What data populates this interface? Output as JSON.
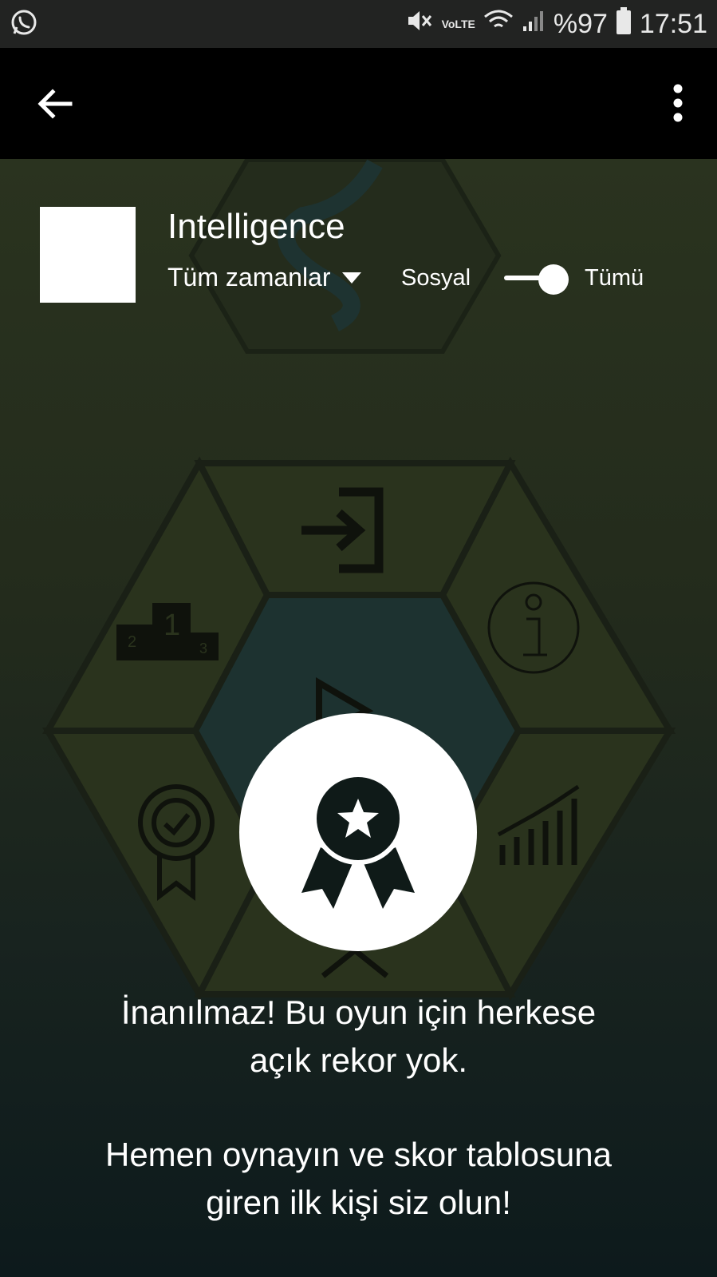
{
  "status_bar": {
    "app_icon": "whatsapp-icon",
    "network_label": "VoLTE",
    "battery_percent": "%97",
    "time": "17:51",
    "icons": [
      "mute-vibrate-icon",
      "volte-icon",
      "wifi-icon",
      "signal-icon",
      "battery-icon"
    ]
  },
  "app_bar": {
    "back_icon": "arrow-back-icon",
    "menu_icon": "more-vert-icon"
  },
  "header": {
    "game_title": "Intelligence",
    "time_filter": "Tüm zamanlar",
    "social_label": "Sosyal",
    "all_label": "Tümü",
    "toggle_state": "Tümü"
  },
  "background": {
    "tiles": [
      "sign-in-icon",
      "leaderboard-podium-icon",
      "info-icon",
      "achievement-icon",
      "stats-chart-icon",
      "play-icon"
    ]
  },
  "empty_state": {
    "badge_icon": "award-ribbon-icon",
    "line1": "İnanılmaz! Bu oyun için herkese",
    "line2": "açık rekor yok.",
    "line3": "Hemen oynayın ve skor tablosuna",
    "line4": "giren ilk kişi siz olun!"
  },
  "colors": {
    "status_bar": "#222322",
    "app_bar": "#000000",
    "background_dark": "#1f251a",
    "tile": "#2a331d",
    "text": "#ffffff"
  }
}
